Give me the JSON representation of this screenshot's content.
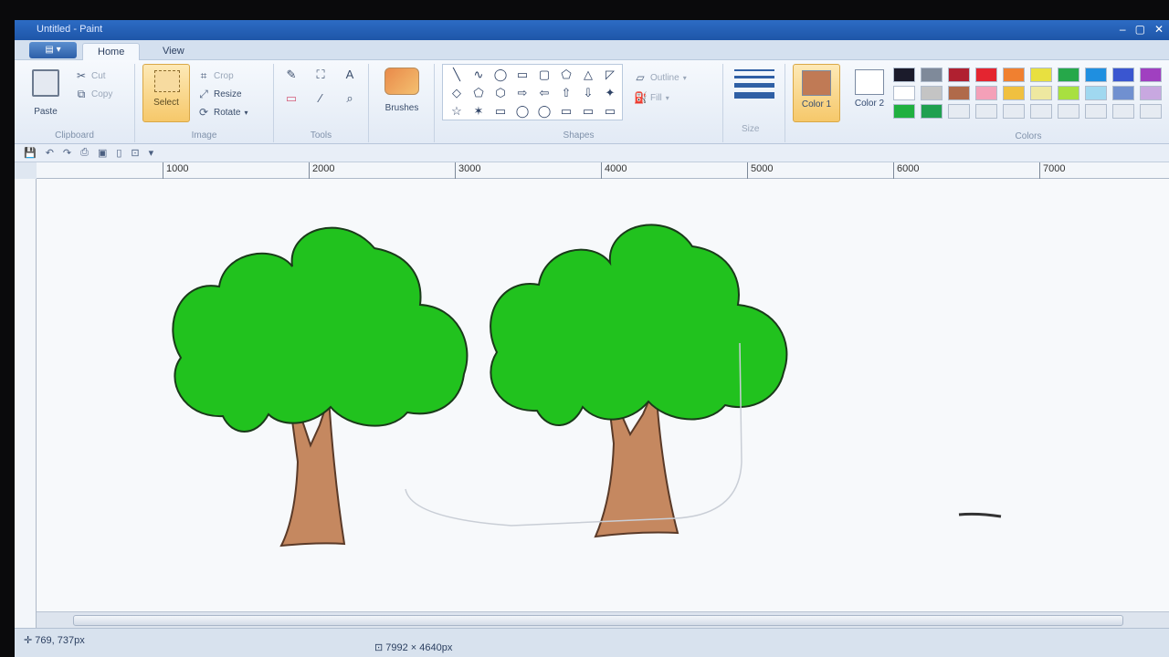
{
  "window": {
    "title": "Untitled - Paint",
    "buttons": [
      "–",
      "▢",
      "✕"
    ]
  },
  "tabs": [
    {
      "label": "Home",
      "active": true
    },
    {
      "label": "View",
      "active": false
    }
  ],
  "clipboard": {
    "paste_label": "Paste",
    "cut_label": "Cut",
    "copy_label": "Copy",
    "group_label": "Clipboard"
  },
  "image": {
    "select_label": "Select",
    "crop_label": "Crop",
    "resize_label": "Resize",
    "rotate_label": "Rotate",
    "group_label": "Image"
  },
  "tools": {
    "group_label": "Tools",
    "icons": [
      "pencil-icon",
      "fill-icon",
      "text-icon",
      "eraser-icon",
      "color-picker-icon",
      "magnifier-icon"
    ],
    "glyphs": [
      "✎",
      "⛶",
      "A",
      "▭",
      "⁄",
      "⌕"
    ]
  },
  "brushes": {
    "label": "Brushes"
  },
  "shapes": {
    "group_label": "Shapes",
    "outline_label": "Outline",
    "fill_label": "Fill",
    "glyphs": [
      "╲",
      "∿",
      "◯",
      "▭",
      "▢",
      "⬠",
      "△",
      "◸",
      "◇",
      "⬠",
      "⬡",
      "⇨",
      "⇦",
      "⇧",
      "⇩",
      "✦",
      "☆",
      "✶",
      "▭",
      "◯",
      "◯",
      "▭",
      "▭",
      "▭"
    ]
  },
  "size": {
    "label": "Size"
  },
  "colors": {
    "color1_label": "Color 1",
    "color2_label": "Color 2",
    "group_label": "Colors",
    "color1": "#c07a55",
    "color2": "#ffffff",
    "palette": [
      "#1b1b2b",
      "#7f8a9a",
      "#b02030",
      "#e42530",
      "#f08030",
      "#e8e040",
      "#26a84a",
      "#1f8fe0",
      "#3a56d0",
      "#a040c0",
      "#ffffff",
      "#c4c4c4",
      "#b06a4a",
      "#f4a0b8",
      "#f0c040",
      "#eee8a0",
      "#a8e040",
      "#a0d8f0",
      "#7090d0",
      "#c8a8e0",
      "#20b040",
      "#20a050",
      "#e6ebf2",
      "#e6ebf2",
      "#e6ebf2",
      "#e6ebf2",
      "#e6ebf2",
      "#e6ebf2",
      "#e6ebf2",
      "#e6ebf2"
    ]
  },
  "ruler": {
    "ticks": [
      "1000",
      "2000",
      "3000",
      "4000",
      "5000",
      "6000",
      "7000"
    ]
  },
  "status": {
    "position": "769, 737px",
    "dimensions": "7992 × 4640px"
  }
}
